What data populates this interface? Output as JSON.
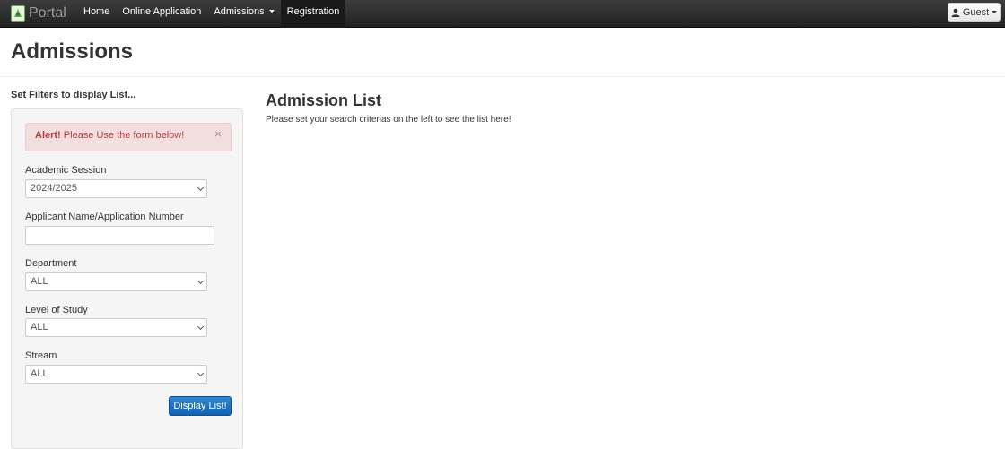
{
  "navbar": {
    "brand": "Portal",
    "items": [
      {
        "label": "Home"
      },
      {
        "label": "Online Application"
      },
      {
        "label": "Admissions",
        "dropdown": true
      },
      {
        "label": "Registration"
      }
    ],
    "user_label": "Guest"
  },
  "page": {
    "title": "Admissions"
  },
  "filters": {
    "title": "Set Filters to display List...",
    "alert": {
      "strong": "Alert!",
      "message": "Please Use the form below!",
      "close": "×"
    },
    "session_label": "Academic Session",
    "session_value": "2024/2025",
    "applicant_label": "Applicant Name/Application Number",
    "applicant_value": "",
    "department_label": "Department",
    "department_value": "ALL",
    "level_label": "Level of Study",
    "level_value": "ALL",
    "stream_label": "Stream",
    "stream_value": "ALL",
    "submit_label": "Display List!"
  },
  "content": {
    "title": "Admission List",
    "description": "Please set your search criterias on the left to see the list here!"
  },
  "colors": {
    "navbar": "#222222",
    "primary": "#1a6fc2",
    "alert_bg": "#f2dede",
    "alert_text": "#a94442"
  }
}
